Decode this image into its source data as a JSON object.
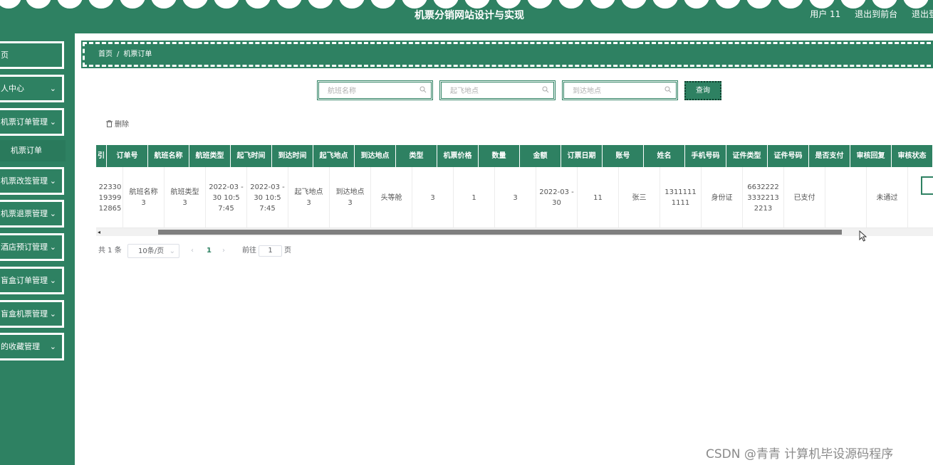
{
  "header": {
    "title": "机票分销网站设计与实现",
    "user": "用户 11",
    "back_to_front": "退出到前台",
    "logout": "退出登"
  },
  "sidebar": {
    "items": [
      {
        "label": "页",
        "chevron": ""
      },
      {
        "label": "人中心",
        "chevron": "⌄"
      },
      {
        "label": "机票订单管理",
        "chevron": "⌄"
      },
      {
        "label": "机票改签管理",
        "chevron": "⌄"
      },
      {
        "label": "机票退票管理",
        "chevron": "⌄"
      },
      {
        "label": "酒店预订管理",
        "chevron": "⌄"
      },
      {
        "label": "盲盒订单管理",
        "chevron": "⌄"
      },
      {
        "label": "盲盒机票管理",
        "chevron": "⌄"
      },
      {
        "label": "的收藏管理",
        "chevron": "⌄"
      }
    ],
    "sub_item": "机票订单"
  },
  "breadcrumb": {
    "home": "首页",
    "sep": "/",
    "current": "机票订单"
  },
  "search": {
    "flight_name_placeholder": "航班名称",
    "departure_placeholder": "起飞地点",
    "arrival_placeholder": "到达地点",
    "button": "查询"
  },
  "actions": {
    "delete": "删除"
  },
  "table": {
    "headers": [
      "引",
      "订单号",
      "航班名称",
      "航班类型",
      "起飞时间",
      "到达时间",
      "起飞地点",
      "到达地点",
      "类型",
      "机票价格",
      "数量",
      "金额",
      "订票日期",
      "账号",
      "姓名",
      "手机号码",
      "证件类型",
      "证件号码",
      "是否支付",
      "审核回复",
      "审核状态"
    ],
    "rows": [
      [
        "",
        "2233019399 12865",
        "航班名称 3",
        "航班类型 3",
        "2022-03 -30 10:5 7:45",
        "2022-03 -30 10:5 7:45",
        "起飞地点 3",
        "到达地点 3",
        "头等舱",
        "3",
        "1",
        "3",
        "2022-03 -30",
        "11",
        "张三",
        "1311111 1111",
        "身份证",
        "6632222 3332213 2213",
        "已支付",
        "",
        "未通过"
      ]
    ]
  },
  "pagination": {
    "total": "共 1 条",
    "page_size": "10条/页",
    "prev": "‹",
    "current": "1",
    "next": "›",
    "goto_label": "前往",
    "goto_value": "1",
    "goto_suffix": "页"
  },
  "watermark": "CSDN @青青  计算机毕设源码程序",
  "colors": {
    "primary": "#2e8162",
    "white": "#ffffff"
  }
}
